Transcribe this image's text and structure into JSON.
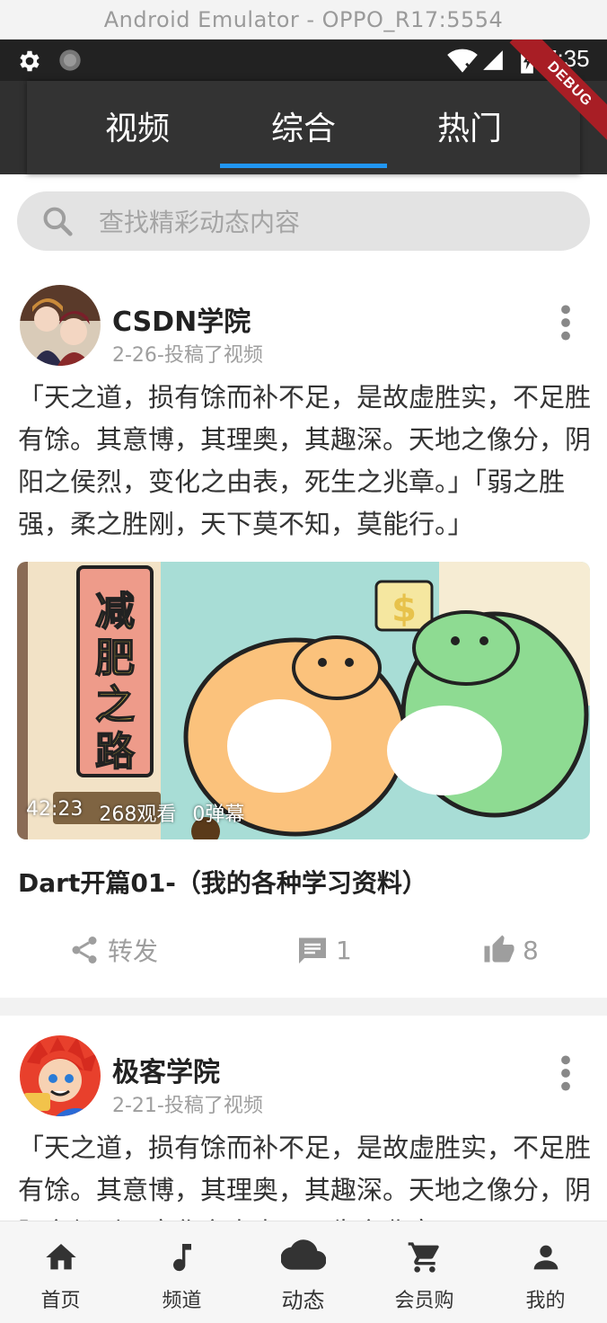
{
  "emulator": {
    "title": "Android Emulator - OPPO_R17:5554"
  },
  "status_bar": {
    "time": "7:35",
    "badge": "DEBUG"
  },
  "tabs": [
    {
      "label": "视频"
    },
    {
      "label": "综合"
    },
    {
      "label": "热门"
    }
  ],
  "active_tab": "综合",
  "accent_color": "#2196f3",
  "search": {
    "placeholder": "查找精彩动态内容"
  },
  "posts": [
    {
      "author": "CSDN学院",
      "meta": "2-26-投稿了视频",
      "text": "「天之道，损有馀而补不足，是故虚胜实，不足胜有馀。其意博，其理奥，其趣深。天地之像分，阴阳之侯烈，变化之由表，死生之兆章。」「弱之胜强，柔之胜刚，天下莫不知，莫能行。」",
      "video": {
        "duration": "42:23",
        "views": "268观看",
        "danmaku": "0弹幕",
        "sign_text": "减肥之路",
        "title": "Dart开篇01-（我的各种学习资料）"
      },
      "actions": {
        "share_label": "转发",
        "comments": "1",
        "likes": "8"
      }
    },
    {
      "author": "极客学院",
      "meta": "2-21-投稿了视频",
      "text": "「天之道，损有馀而补不足，是故虚胜实，不足胜有馀。其意博，其理奥，其趣深。天地之像分，阴阳之侯烈，变化之由表，死生之兆章。」"
    }
  ],
  "bottom_nav": [
    {
      "label": "首页",
      "icon": "home-icon"
    },
    {
      "label": "频道",
      "icon": "music-note-icon"
    },
    {
      "label": "动态",
      "icon": "cloud-icon"
    },
    {
      "label": "会员购",
      "icon": "cart-icon"
    },
    {
      "label": "我的",
      "icon": "person-icon"
    }
  ],
  "active_nav": "动态"
}
